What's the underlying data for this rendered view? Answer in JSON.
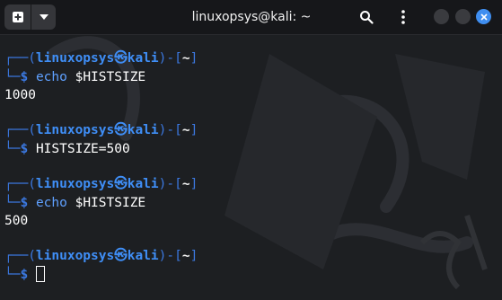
{
  "window": {
    "title": "linuxopsys@kali: ~"
  },
  "prompt": {
    "top_left": "┌──(",
    "user": "linuxopsys㉿kali",
    "close_paren": ")-[",
    "cwd": "~",
    "close_bracket": "]",
    "bottom_left": "└─",
    "dollar": "$"
  },
  "blocks": [
    {
      "command_name": "echo",
      "command_args": " $HISTSIZE",
      "output": "1000"
    },
    {
      "command_name": "",
      "command_args": "HISTSIZE=500",
      "output": ""
    },
    {
      "command_name": "echo",
      "command_args": " $HISTSIZE",
      "output": "500"
    },
    {
      "command_name": "",
      "command_args": "",
      "output": ""
    }
  ],
  "icons": {
    "new_tab": "new-tab-icon",
    "menu": "chevron-down-icon",
    "search": "search-icon",
    "kebab": "kebab-menu-icon",
    "close": "close-icon"
  },
  "colors": {
    "accent_blue": "#3b78e0",
    "user_blue": "#3f8ef6",
    "close_button": "#3f8ef0",
    "background": "#1d1f22"
  }
}
